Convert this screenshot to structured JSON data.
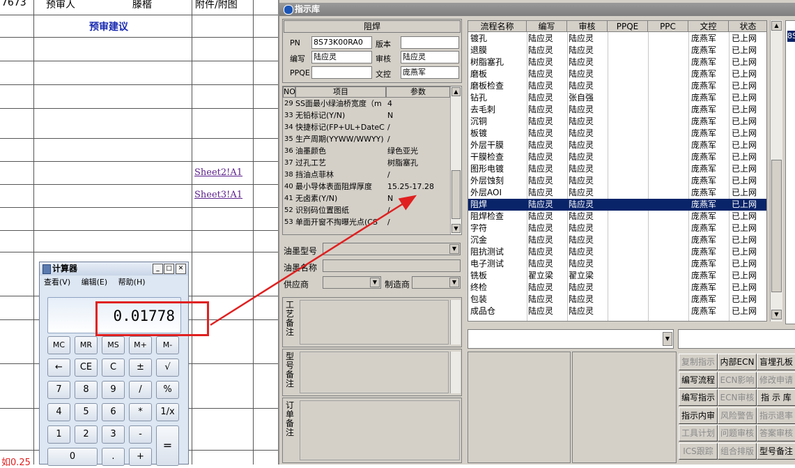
{
  "sheet": {
    "header_cells": [
      "7673",
      "预审人",
      "滕楷",
      "附件/附图"
    ],
    "suggestion_title": "预审建议",
    "links": [
      "Sheet2!A1",
      "Sheet3!A1"
    ],
    "bottom_red_text": "如0.25"
  },
  "window": {
    "title": "指示库",
    "step_name": "阻焊",
    "labels": {
      "pn": "PN",
      "version": "版本",
      "author": "编写",
      "reviewer": "审核",
      "ppqe": "PPQE",
      "doc_control": "文控"
    },
    "values": {
      "pn": "8S73K00RA0",
      "version": "",
      "author": "陆应灵",
      "reviewer": "陆应灵",
      "ppqe": "",
      "doc_control": "庞燕军"
    },
    "param_headers": [
      "NO",
      "项目",
      "参数"
    ],
    "params": [
      {
        "no": "29",
        "item": "SS面最小绿油桥宽度（m",
        "value": "4"
      },
      {
        "no": "33",
        "item": "无铅标记(Y/N)",
        "value": "N"
      },
      {
        "no": "34",
        "item": "快捷标记(FP+UL+DateCo",
        "value": "/"
      },
      {
        "no": "35",
        "item": "生产周期(YYWW/WWYY)",
        "value": "/"
      },
      {
        "no": "36",
        "item": "油墨颜色",
        "value": "绿色亚光"
      },
      {
        "no": "37",
        "item": "过孔工艺",
        "value": "树脂塞孔"
      },
      {
        "no": "38",
        "item": "挡油点菲林",
        "value": "/"
      },
      {
        "no": "40",
        "item": "最小导体表面阻焊厚度",
        "value": "15.25-17.28"
      },
      {
        "no": "41",
        "item": "无卤素(Y/N)",
        "value": "N"
      },
      {
        "no": "52",
        "item": "识别码位置图纸",
        "value": "/"
      },
      {
        "no": "53",
        "item": "单面开窗不掏曝光点(CS",
        "value": "/"
      }
    ],
    "ink_model_label": "油墨型号",
    "ink_name_label": "油墨名称",
    "supplier_label": "供应商",
    "manufacturer_label": "制造商",
    "note_labels": [
      "工艺备注",
      "型号备注",
      "订单备注"
    ],
    "table_headers": [
      "流程名称",
      "编写",
      "审核",
      "PPQE",
      "PPC",
      "文控",
      "状态"
    ],
    "processes": [
      {
        "name": "镀孔",
        "author": "陆应灵",
        "reviewer": "陆应灵",
        "doc": "庞燕军",
        "status": "已上网"
      },
      {
        "name": "退膜",
        "author": "陆应灵",
        "reviewer": "陆应灵",
        "doc": "庞燕军",
        "status": "已上网"
      },
      {
        "name": "树脂塞孔",
        "author": "陆应灵",
        "reviewer": "陆应灵",
        "doc": "庞燕军",
        "status": "已上网"
      },
      {
        "name": "磨板",
        "author": "陆应灵",
        "reviewer": "陆应灵",
        "doc": "庞燕军",
        "status": "已上网"
      },
      {
        "name": "磨板检查",
        "author": "陆应灵",
        "reviewer": "陆应灵",
        "doc": "庞燕军",
        "status": "已上网"
      },
      {
        "name": "钻孔",
        "author": "陆应灵",
        "reviewer": "张自强",
        "doc": "庞燕军",
        "status": "已上网"
      },
      {
        "name": "去毛刺",
        "author": "陆应灵",
        "reviewer": "陆应灵",
        "doc": "庞燕军",
        "status": "已上网"
      },
      {
        "name": "沉铜",
        "author": "陆应灵",
        "reviewer": "陆应灵",
        "doc": "庞燕军",
        "status": "已上网"
      },
      {
        "name": "板镀",
        "author": "陆应灵",
        "reviewer": "陆应灵",
        "doc": "庞燕军",
        "status": "已上网"
      },
      {
        "name": "外层干膜",
        "author": "陆应灵",
        "reviewer": "陆应灵",
        "doc": "庞燕军",
        "status": "已上网"
      },
      {
        "name": "干膜检查",
        "author": "陆应灵",
        "reviewer": "陆应灵",
        "doc": "庞燕军",
        "status": "已上网"
      },
      {
        "name": "图形电镀",
        "author": "陆应灵",
        "reviewer": "陆应灵",
        "doc": "庞燕军",
        "status": "已上网"
      },
      {
        "name": "外层蚀刻",
        "author": "陆应灵",
        "reviewer": "陆应灵",
        "doc": "庞燕军",
        "status": "已上网"
      },
      {
        "name": "外层AOI",
        "author": "陆应灵",
        "reviewer": "陆应灵",
        "doc": "庞燕军",
        "status": "已上网"
      },
      {
        "name": "阻焊",
        "author": "陆应灵",
        "reviewer": "陆应灵",
        "doc": "庞燕军",
        "status": "已上网"
      },
      {
        "name": "阻焊检查",
        "author": "陆应灵",
        "reviewer": "陆应灵",
        "doc": "庞燕军",
        "status": "已上网"
      },
      {
        "name": "字符",
        "author": "陆应灵",
        "reviewer": "陆应灵",
        "doc": "庞燕军",
        "status": "已上网"
      },
      {
        "name": "沉金",
        "author": "陆应灵",
        "reviewer": "陆应灵",
        "doc": "庞燕军",
        "status": "已上网"
      },
      {
        "name": "阻抗测试",
        "author": "陆应灵",
        "reviewer": "陆应灵",
        "doc": "庞燕军",
        "status": "已上网"
      },
      {
        "name": "电子测试",
        "author": "陆应灵",
        "reviewer": "陆应灵",
        "doc": "庞燕军",
        "status": "已上网"
      },
      {
        "name": "铣板",
        "author": "翟立梁",
        "reviewer": "翟立梁",
        "doc": "庞燕军",
        "status": "已上网"
      },
      {
        "name": "终检",
        "author": "陆应灵",
        "reviewer": "陆应灵",
        "doc": "庞燕军",
        "status": "已上网"
      },
      {
        "name": "包装",
        "author": "陆应灵",
        "reviewer": "陆应灵",
        "doc": "庞燕军",
        "status": "已上网"
      },
      {
        "name": "成品仓",
        "author": "陆应灵",
        "reviewer": "陆应灵",
        "doc": "庞燕军",
        "status": "已上网"
      }
    ],
    "selected_process": "阻焊",
    "side_value": "8S",
    "buttons": [
      [
        "复制指示",
        "内部ECN",
        "盲埋孔板"
      ],
      [
        "编写流程",
        "ECN影响",
        "修改申请"
      ],
      [
        "编写指示",
        "ECN审核",
        "指 示 库"
      ],
      [
        "指示内审",
        "风险警告",
        "指示退率"
      ],
      [
        "工具计划",
        "问题审核",
        "答案审核"
      ],
      [
        "ICS跟踪",
        "组合排版",
        "型号备注"
      ]
    ],
    "buttons_enabled": [
      [
        false,
        true,
        true
      ],
      [
        true,
        false,
        false
      ],
      [
        true,
        false,
        true
      ],
      [
        true,
        false,
        false
      ],
      [
        false,
        false,
        false
      ],
      [
        false,
        false,
        true
      ]
    ]
  },
  "calculator": {
    "title": "计算器",
    "menu": [
      "查看(V)",
      "编辑(E)",
      "帮助(H)"
    ],
    "display": "0.01778",
    "keys": [
      [
        "MC",
        "MR",
        "MS",
        "M+",
        "M-"
      ],
      [
        "←",
        "CE",
        "C",
        "±",
        "√"
      ],
      [
        "7",
        "8",
        "9",
        "/",
        "%"
      ],
      [
        "4",
        "5",
        "6",
        "*",
        "1/x"
      ],
      [
        "1",
        "2",
        "3",
        "-",
        "="
      ],
      [
        "0",
        ".",
        "+"
      ]
    ]
  },
  "colors": {
    "selection": "#0a246a",
    "annotation": "#e02020",
    "link": "#5a1e8c",
    "heading": "#1a2bb0"
  }
}
